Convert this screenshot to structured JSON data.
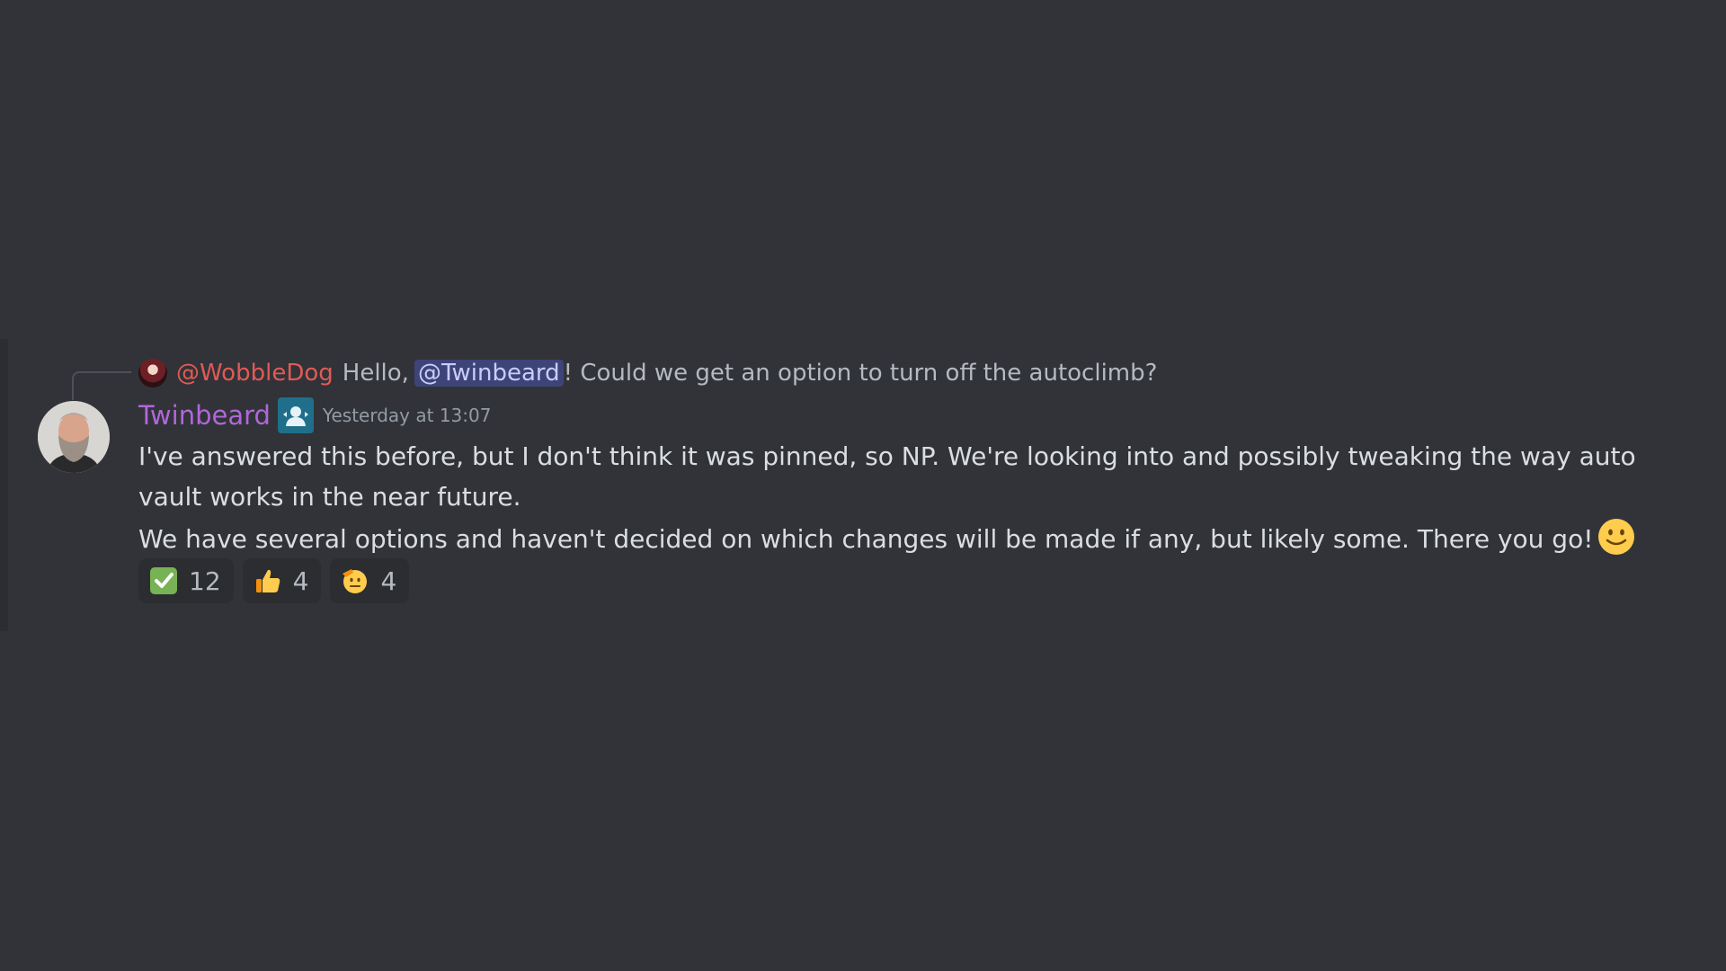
{
  "reply": {
    "author": "@WobbleDog",
    "text_pre": "Hello,",
    "mention": "@Twinbeard",
    "text_post": "! Could we get an option to turn off the autoclimb?"
  },
  "message": {
    "author": "Twinbeard",
    "timestamp": "Yesterday at 13:07",
    "line1": "I've answered this before, but I don't think it was pinned, so NP. We're looking into and possibly tweaking the way auto vault works in the near future.",
    "line2": "We have several options and haven't decided on which changes will be made if any, but likely some. There you go!",
    "inline_emoji": "slightly-smiling-face"
  },
  "reactions": [
    {
      "emoji": "white-check-mark",
      "count": "12"
    },
    {
      "emoji": "thumbs-up",
      "count": "4"
    },
    {
      "emoji": "saluting-face",
      "count": "4"
    }
  ],
  "colors": {
    "background": "#313338",
    "username": "#b067d8",
    "reply_author": "#e15a56",
    "mention_bg": "#5865f2",
    "text": "#dbdee1",
    "muted": "#949ba4",
    "reaction_bg": "#2b2d31"
  }
}
